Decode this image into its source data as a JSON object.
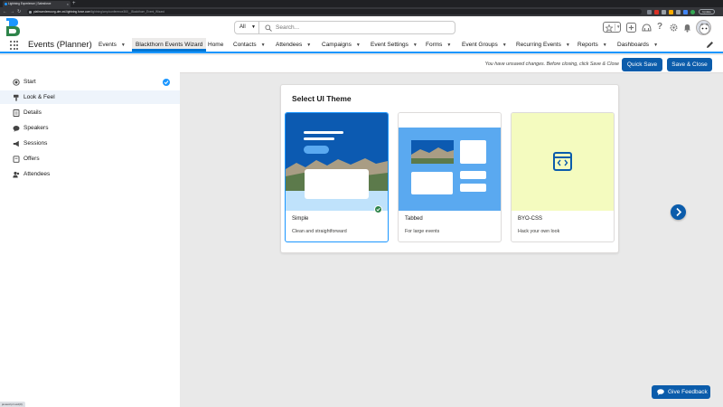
{
  "browser": {
    "tab_title": "Lightning Experience | Salesforce",
    "url_main": "platinumdemoorg-dev-ed.lightning.force.com",
    "url_path": "/lightning/cmp/conference360__Blackthorn_Event_Wizard",
    "update_label": "Update",
    "new_tab_symbol": "+",
    "tab_close_symbol": "×",
    "status_text": "javascript:void(0);"
  },
  "header": {
    "search_scope": "All",
    "search_placeholder": "Search..."
  },
  "app": {
    "name": "Events (Planner)",
    "nav_items": [
      {
        "label": "Events",
        "has_menu": true
      },
      {
        "label": "Blackthorn Events Wizard",
        "has_menu": false,
        "active": true
      },
      {
        "label": "Home",
        "has_menu": false
      },
      {
        "label": "Contacts",
        "has_menu": true
      },
      {
        "label": "Attendees",
        "has_menu": true
      },
      {
        "label": "Campaigns",
        "has_menu": true
      },
      {
        "label": "Event Settings",
        "has_menu": true
      },
      {
        "label": "Forms",
        "has_menu": true
      },
      {
        "label": "Event Groups",
        "has_menu": true
      },
      {
        "label": "Recurring Events",
        "has_menu": true
      },
      {
        "label": "Reports",
        "has_menu": true
      },
      {
        "label": "Dashboards",
        "has_menu": true
      }
    ]
  },
  "sidebar": {
    "items": [
      {
        "label": "Start",
        "icon": "start-icon",
        "completed": true
      },
      {
        "label": "Look & Feel",
        "icon": "paint-icon",
        "active": true
      },
      {
        "label": "Details",
        "icon": "details-icon"
      },
      {
        "label": "Speakers",
        "icon": "speakers-icon"
      },
      {
        "label": "Sessions",
        "icon": "megaphone-icon"
      },
      {
        "label": "Offers",
        "icon": "offers-icon"
      },
      {
        "label": "Attendees",
        "icon": "attendees-icon"
      }
    ]
  },
  "savebar": {
    "message": "You have unsaved changes. Before closing, click Save & Close",
    "quick_save": "Quick Save",
    "save_close": "Save & Close"
  },
  "theme_picker": {
    "title": "Select UI Theme",
    "themes": [
      {
        "name": "Simple",
        "description": "Clean and straightforward",
        "selected": true
      },
      {
        "name": "Tabbed",
        "description": "For large events",
        "selected": false
      },
      {
        "name": "BYO-CSS",
        "description": "Hack your own look",
        "selected": false
      }
    ]
  },
  "feedback": {
    "label": "Give Feedback"
  },
  "colors": {
    "brand": "#0b5cab",
    "accent": "#1b96ff",
    "byo_tile": "#f4fbbf",
    "tabbed_tile": "#5aa9f0",
    "success": "#2e844a"
  }
}
